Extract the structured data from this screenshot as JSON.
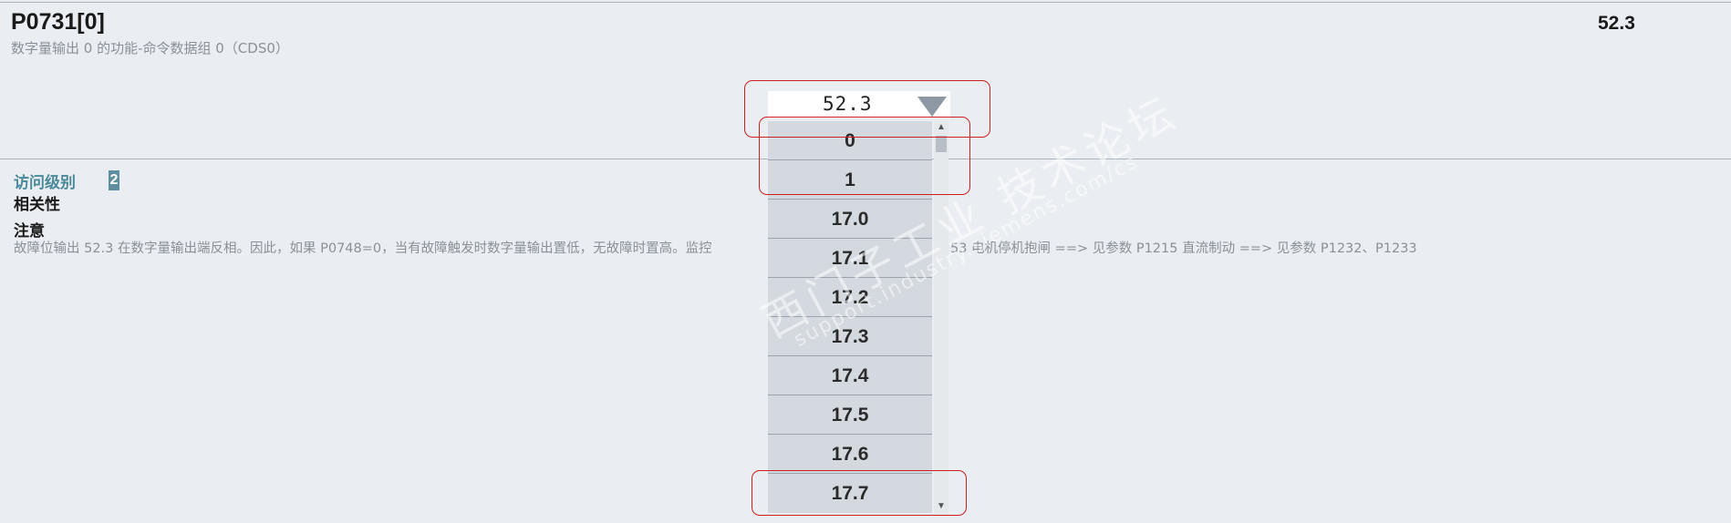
{
  "header": {
    "param_id": "P0731[0]",
    "description": "数字量输出 0 的功能-命令数据组 0（CDS0）",
    "current_value": "52.3"
  },
  "selector": {
    "value": "52.3",
    "arrow_icon": "triangle-down-icon",
    "options": [
      "0",
      "1",
      "17.0",
      "17.1",
      "17.2",
      "17.3",
      "17.4",
      "17.5",
      "17.6",
      "17.7"
    ]
  },
  "info": {
    "access_label": "访问级别",
    "access_level": "2",
    "dependency_label": "相关性",
    "note_label": "注意",
    "note_text_left": "故障位输出 52.3 在数字量输出端反相。因此，如果 P0748=0，当有故障触发时数字量输出置低，无故障时置高。监控",
    "note_text_right": "53 电机停机抱闸 ==> 见参数 P1215 直流制动 ==> 见参数 P1232、P1233"
  },
  "watermark": {
    "line1": "西门子工业 技术论坛",
    "line2": "support.industry.siemens.com/cs"
  },
  "colors": {
    "background": "#eaeef2",
    "highlight": "#cc1f1f",
    "access_label": "#4b8a9a",
    "dropdown": "#d3d9df"
  }
}
